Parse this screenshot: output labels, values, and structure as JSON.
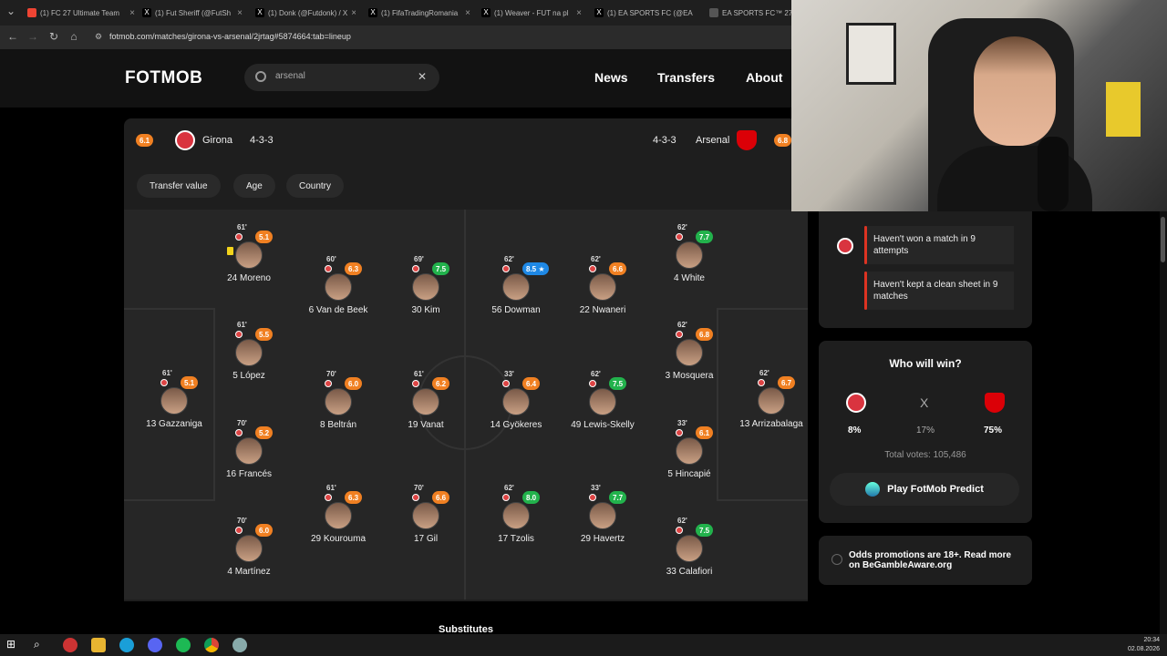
{
  "browser": {
    "tabs": [
      {
        "label": "(1) FC 27 Ultimate Team",
        "color": "#e43"
      },
      {
        "label": "(1) Fut Sheriff (@FutSh",
        "color": "#222"
      },
      {
        "label": "(1) Donk (@Futdonk) / X",
        "color": "#222"
      },
      {
        "label": "(1) FifaTradingRomania",
        "color": "#222"
      },
      {
        "label": "(1) Weaver - FUT na pl",
        "color": "#222"
      },
      {
        "label": "(1) EA SPORTS FC (@EA",
        "color": "#222"
      },
      {
        "label": "EA SPORTS FC™ 27 | FU",
        "color": "#555"
      }
    ],
    "url": "fotmob.com/matches/girona-vs-arsenal/2jrtag#5874664:tab=lineup"
  },
  "header": {
    "logo": "FOTMOB",
    "search_value": "arsenal",
    "nav": [
      "News",
      "Transfers",
      "About"
    ]
  },
  "match": {
    "home": {
      "name": "Girona",
      "formation": "4-3-3",
      "rating": "6.1"
    },
    "away": {
      "name": "Arsenal",
      "formation": "4-3-3",
      "rating": "6.8"
    },
    "filters": [
      "Transfer value",
      "Age",
      "Country"
    ],
    "players": [
      {
        "name": "13 Gazzaniga",
        "minute": "61'",
        "rating": "5.1",
        "rt": "orange"
      },
      {
        "name": "24 Moreno",
        "minute": "61'",
        "rating": "5.1",
        "rt": "orange"
      },
      {
        "name": "5 López",
        "minute": "61'",
        "rating": "5.5",
        "rt": "orange"
      },
      {
        "name": "16 Francés",
        "minute": "70'",
        "rating": "5.2",
        "rt": "orange"
      },
      {
        "name": "4 Martínez",
        "minute": "70'",
        "rating": "6.0",
        "rt": "orange"
      },
      {
        "name": "6 Van de Beek",
        "minute": "60'",
        "rating": "6.3",
        "rt": "orange"
      },
      {
        "name": "8 Beltrán",
        "minute": "70'",
        "rating": "6.0",
        "rt": "orange"
      },
      {
        "name": "29 Kourouma",
        "minute": "61'",
        "rating": "6.3",
        "rt": "orange"
      },
      {
        "name": "30 Kim",
        "minute": "69'",
        "rating": "7.5",
        "rt": "green"
      },
      {
        "name": "19 Vanat",
        "minute": "61'",
        "rating": "6.2",
        "rt": "orange"
      },
      {
        "name": "17 Gil",
        "minute": "70'",
        "rating": "6.6",
        "rt": "orange"
      },
      {
        "name": "56 Dowman",
        "minute": "62'",
        "rating": "8.5 ★",
        "rt": "blue"
      },
      {
        "name": "14 Gyökeres",
        "minute": "33'",
        "rating": "6.4",
        "rt": "orange"
      },
      {
        "name": "17 Tzolis",
        "minute": "62'",
        "rating": "8.0",
        "rt": "green"
      },
      {
        "name": "22 Nwaneri",
        "minute": "62'",
        "rating": "6.6",
        "rt": "orange"
      },
      {
        "name": "49 Lewis-Skelly",
        "minute": "62'",
        "rating": "7.5",
        "rt": "green"
      },
      {
        "name": "29 Havertz",
        "minute": "33'",
        "rating": "7.7",
        "rt": "green"
      },
      {
        "name": "4 White",
        "minute": "62'",
        "rating": "7.7",
        "rt": "green"
      },
      {
        "name": "3 Mosquera",
        "minute": "62'",
        "rating": "6.8",
        "rt": "orange"
      },
      {
        "name": "5 Hincapié",
        "minute": "33'",
        "rating": "6.1",
        "rt": "orange"
      },
      {
        "name": "33 Calafiori",
        "minute": "62'",
        "rating": "7.5",
        "rt": "green"
      },
      {
        "name": "13 Arrizabalaga",
        "minute": "62'",
        "rating": "6.7",
        "rt": "orange"
      }
    ],
    "substitutes_title": "Substitutes"
  },
  "side": {
    "facts": [
      "Haven't won a match in 9 attempts",
      "Haven't kept a clean sheet in 9 matches"
    ],
    "poll": {
      "title": "Who will win?",
      "draw": "X",
      "home_pct": "8%",
      "draw_pct": "17%",
      "away_pct": "75%",
      "total": "Total votes: 105,486",
      "cta": "Play FotMob Predict"
    },
    "odds": "Odds promotions are 18+. Read more on BeGambleAware.org"
  },
  "taskbar": {
    "time": "20:34",
    "date": "02.08.2026"
  },
  "colors": {
    "orange": "#f08022",
    "green": "#22b24c",
    "blue": "#1e88e5",
    "girona": "#d9343f",
    "arsenal": "#db0007"
  }
}
